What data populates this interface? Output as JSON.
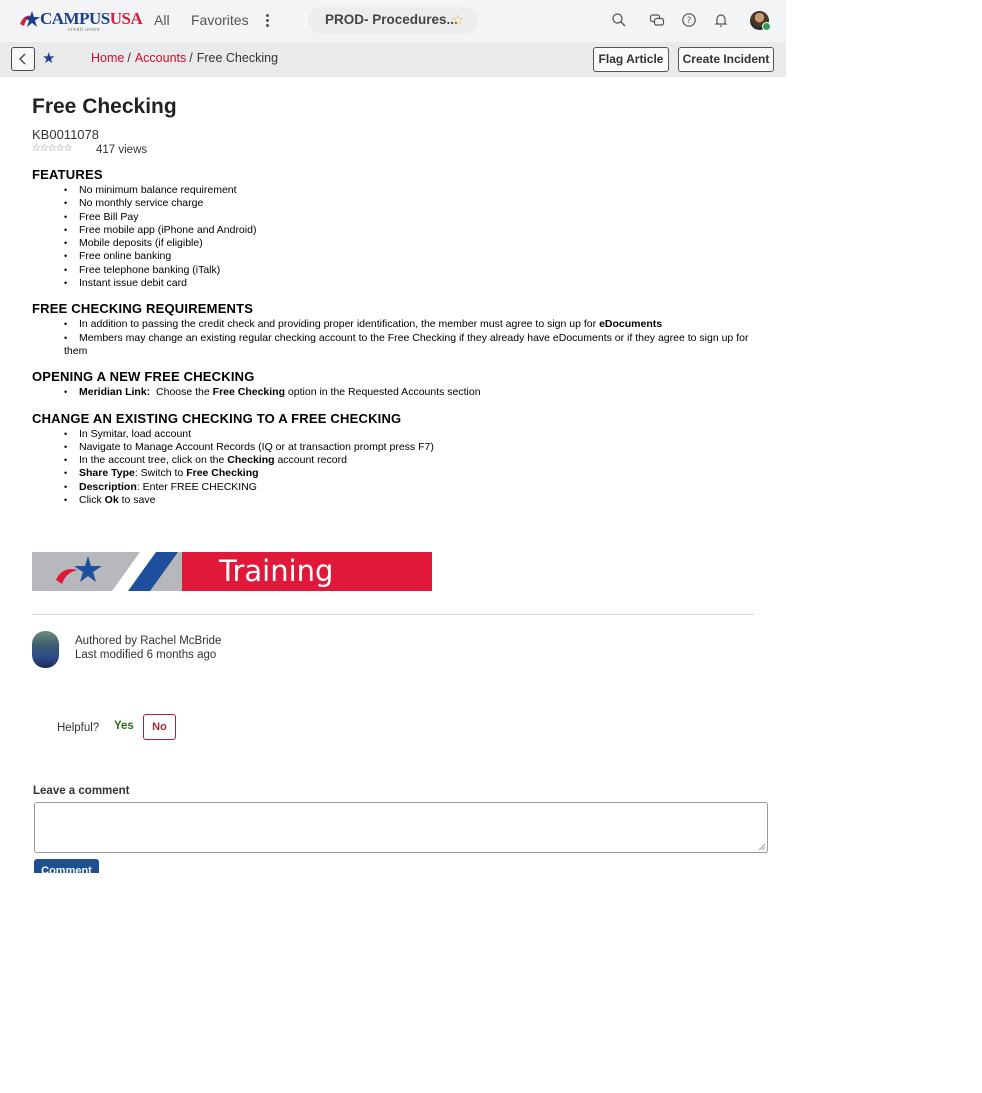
{
  "header": {
    "logo_text_campus": "CAMPUS",
    "logo_text_usa": "USA",
    "logo_subtext": "credit union",
    "nav_all": "All",
    "nav_favorites": "Favorites",
    "pill_title": "PROD- Procedures...",
    "icons": [
      "more-icon",
      "star-icon",
      "search-icon",
      "chat-icon",
      "help-icon",
      "bell-icon",
      "avatar"
    ]
  },
  "subbar": {
    "breadcrumbs": [
      "Home",
      "Accounts",
      "Free Checking"
    ],
    "breadcrumb_sep": "/",
    "flag_label": "Flag Article",
    "incident_label": "Create Incident"
  },
  "article": {
    "title": "Free Checking",
    "number": "KB0011078",
    "rating_stars": "☆☆☆☆☆",
    "views": "417 views",
    "sections": [
      {
        "heading": "FEATURES",
        "items": [
          "No minimum balance requirement",
          "No monthly service charge",
          "Free Bill Pay",
          "Free mobile app (iPhone and Android)",
          "Mobile deposits (if eligible)",
          "Free online banking",
          "Free telephone banking (iTalk)",
          "Instant issue debit card"
        ]
      },
      {
        "heading": "FREE CHECKING REQUIREMENTS",
        "req1_text": "In addition to passing the credit check and providing proper identification, the member must agree to sign up for ",
        "req1_bold": "eDocuments",
        "req2_text": "Members may change an existing regular checking account to the Free Checking if they already have eDocuments or if they agree to sign up for them"
      },
      {
        "heading": "OPENING A NEW FREE CHECKING",
        "ml_bold": "Meridian Link:",
        "ml_text1": "  Choose the ",
        "ml_bold2": "Free Checking",
        "ml_text2": " option in the Requested Accounts section"
      },
      {
        "heading": "CHANGE AN EXISTING CHECKING TO A FREE CHECKING",
        "s1": "In Symitar, load account",
        "s2": "Navigate to Manage Account Records (IQ or at transaction prompt press F7)",
        "s3a": "In the account tree, click on the ",
        "s3b": "Checking",
        "s3c": " account record",
        "s4a": "Share Type",
        "s4b": ": Switch to ",
        "s4c": "Free Checking",
        "s5a": "Description",
        "s5b": ": Enter FREE CHECKING",
        "s6a": "Click ",
        "s6b": "Ok",
        "s6c": " to save"
      }
    ],
    "banner_text": "Training"
  },
  "meta": {
    "authored_by": "Authored by Rachel McBride",
    "last_modified": "Last modified 6 months ago"
  },
  "feedback": {
    "helpful_label": "Helpful?",
    "yes_label": "Yes",
    "no_label": "No"
  },
  "comment": {
    "label": "Leave a comment",
    "button_label": "Comment"
  },
  "colors": {
    "brand_blue": "#1e3f8c",
    "brand_red": "#c8102e",
    "button_blue": "#1e4f91"
  }
}
